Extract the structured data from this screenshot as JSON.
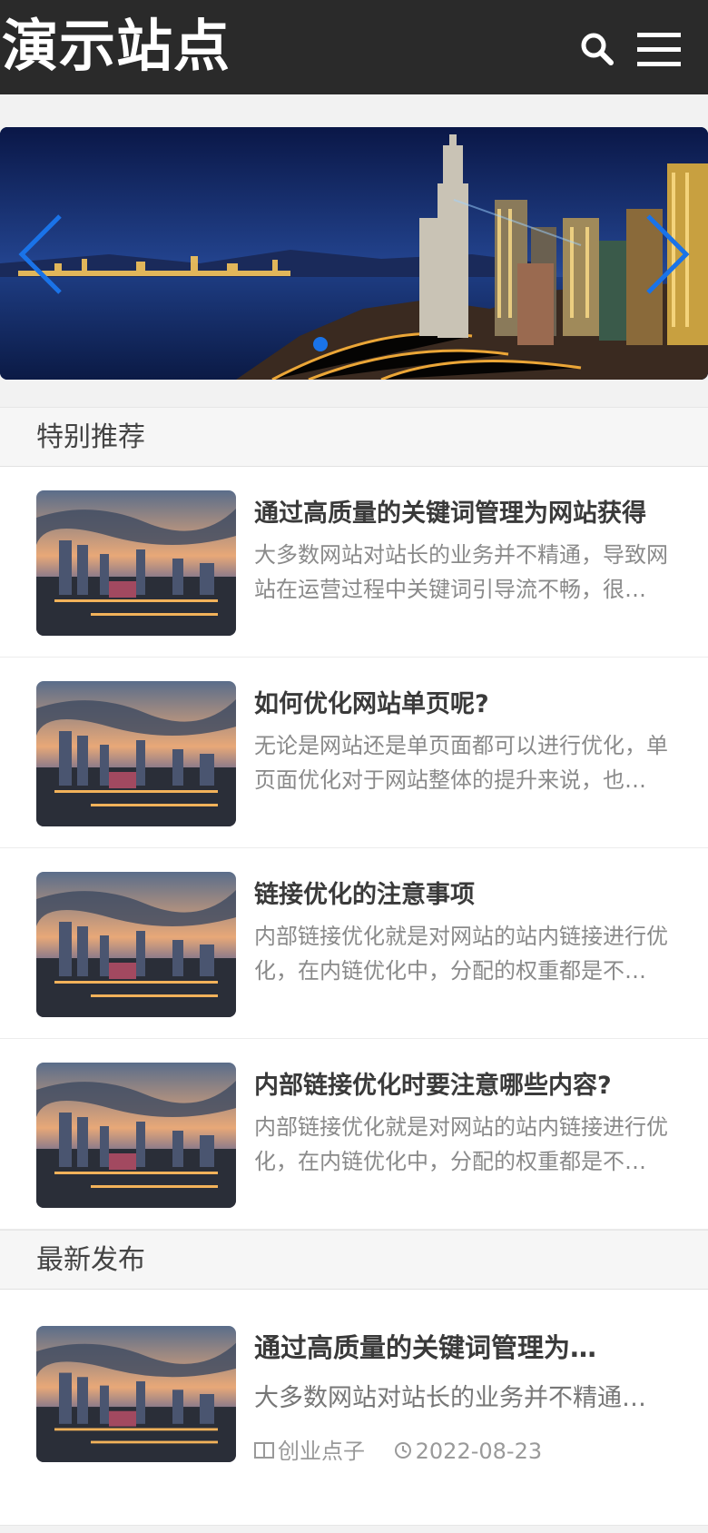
{
  "header": {
    "logo": "演示站点"
  },
  "sections": {
    "featured_title": "特别推荐",
    "latest_title": "最新发布"
  },
  "featured": [
    {
      "title": "通过高质量的关键词管理为网站获得",
      "desc": "大多数网站对站长的业务并不精通，导致网站在运营过程中关键词引导流不畅，很…"
    },
    {
      "title": "如何优化网站单页呢?",
      "desc": "无论是网站还是单页面都可以进行优化，单页面优化对于网站整体的提升来说，也…"
    },
    {
      "title": "链接优化的注意事项",
      "desc": "内部链接优化就是对网站的站内链接进行优化，在内链优化中，分配的权重都是不…"
    },
    {
      "title": "内部链接优化时要注意哪些内容?",
      "desc": "内部链接优化就是对网站的站内链接进行优化，在内链优化中，分配的权重都是不…"
    }
  ],
  "latest": {
    "title": "通过高质量的关键词管理为…",
    "desc": "大多数网站对站长的业务并不精通…",
    "category": "创业点子",
    "date": "2022-08-23"
  },
  "icons": {
    "search": "search-icon",
    "menu": "menu-icon",
    "prev": "chevron-left-icon",
    "next": "chevron-right-icon",
    "category": "book-icon",
    "date": "clock-icon"
  },
  "colors": {
    "header_bg": "#2a2a2a",
    "accent": "#1a73e8",
    "page_bg": "#f2f2f2"
  }
}
